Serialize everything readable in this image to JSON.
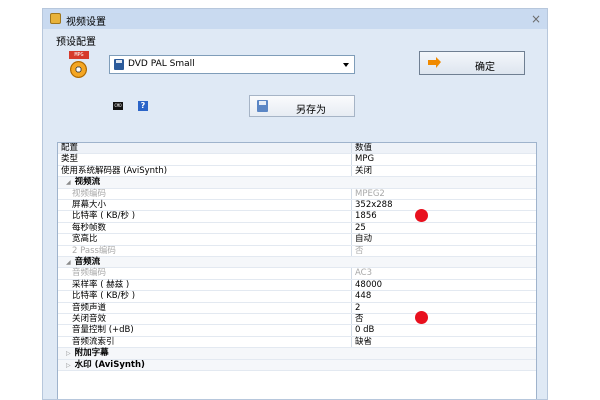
{
  "window": {
    "title": "视频设置",
    "close_glyph": "×"
  },
  "preset": {
    "group_title": "预设配置",
    "icon_tag": "MPG",
    "selected": "DVD PAL Small",
    "ok_label": "确定",
    "cmd_icon_text": "CMD",
    "help_icon_text": "?",
    "saveas_label": "另存为"
  },
  "grid": {
    "headers": [
      "配置",
      "数值"
    ],
    "rows": [
      {
        "name": "类型",
        "value": "MPG",
        "kind": "prop"
      },
      {
        "name": "使用系统解码器 (AviSynth)",
        "value": "关闭",
        "kind": "prop"
      },
      {
        "name": "视频流",
        "value": "",
        "kind": "cat-open"
      },
      {
        "name": "视频编码",
        "value": "MPEG2",
        "kind": "disabled"
      },
      {
        "name": "屏幕大小",
        "value": "352x288",
        "kind": "sub"
      },
      {
        "name": "比特率 ( KB/秒 )",
        "value": "1856",
        "kind": "sub"
      },
      {
        "name": "每秒帧数",
        "value": "25",
        "kind": "sub"
      },
      {
        "name": "宽高比",
        "value": "自动",
        "kind": "sub"
      },
      {
        "name": "2 Pass编码",
        "value": "否",
        "kind": "disabled"
      },
      {
        "name": "音频流",
        "value": "",
        "kind": "cat-open"
      },
      {
        "name": "音频编码",
        "value": "AC3",
        "kind": "disabled"
      },
      {
        "name": "采样率 ( 赫兹 )",
        "value": "48000",
        "kind": "sub"
      },
      {
        "name": "比特率 ( KB/秒 )",
        "value": "448",
        "kind": "sub"
      },
      {
        "name": "音频声道",
        "value": "2",
        "kind": "sub"
      },
      {
        "name": "关闭音效",
        "value": "否",
        "kind": "sub"
      },
      {
        "name": "音量控制 (+dB)",
        "value": "0 dB",
        "kind": "sub"
      },
      {
        "name": "音频流索引",
        "value": "缺省",
        "kind": "sub"
      },
      {
        "name": "附加字幕",
        "value": "",
        "kind": "cat-closed"
      },
      {
        "name": "水印 (AviSynth)",
        "value": "",
        "kind": "cat-closed"
      }
    ]
  },
  "colors": {
    "marker": "#e8101e",
    "accent": "#f08a00"
  }
}
